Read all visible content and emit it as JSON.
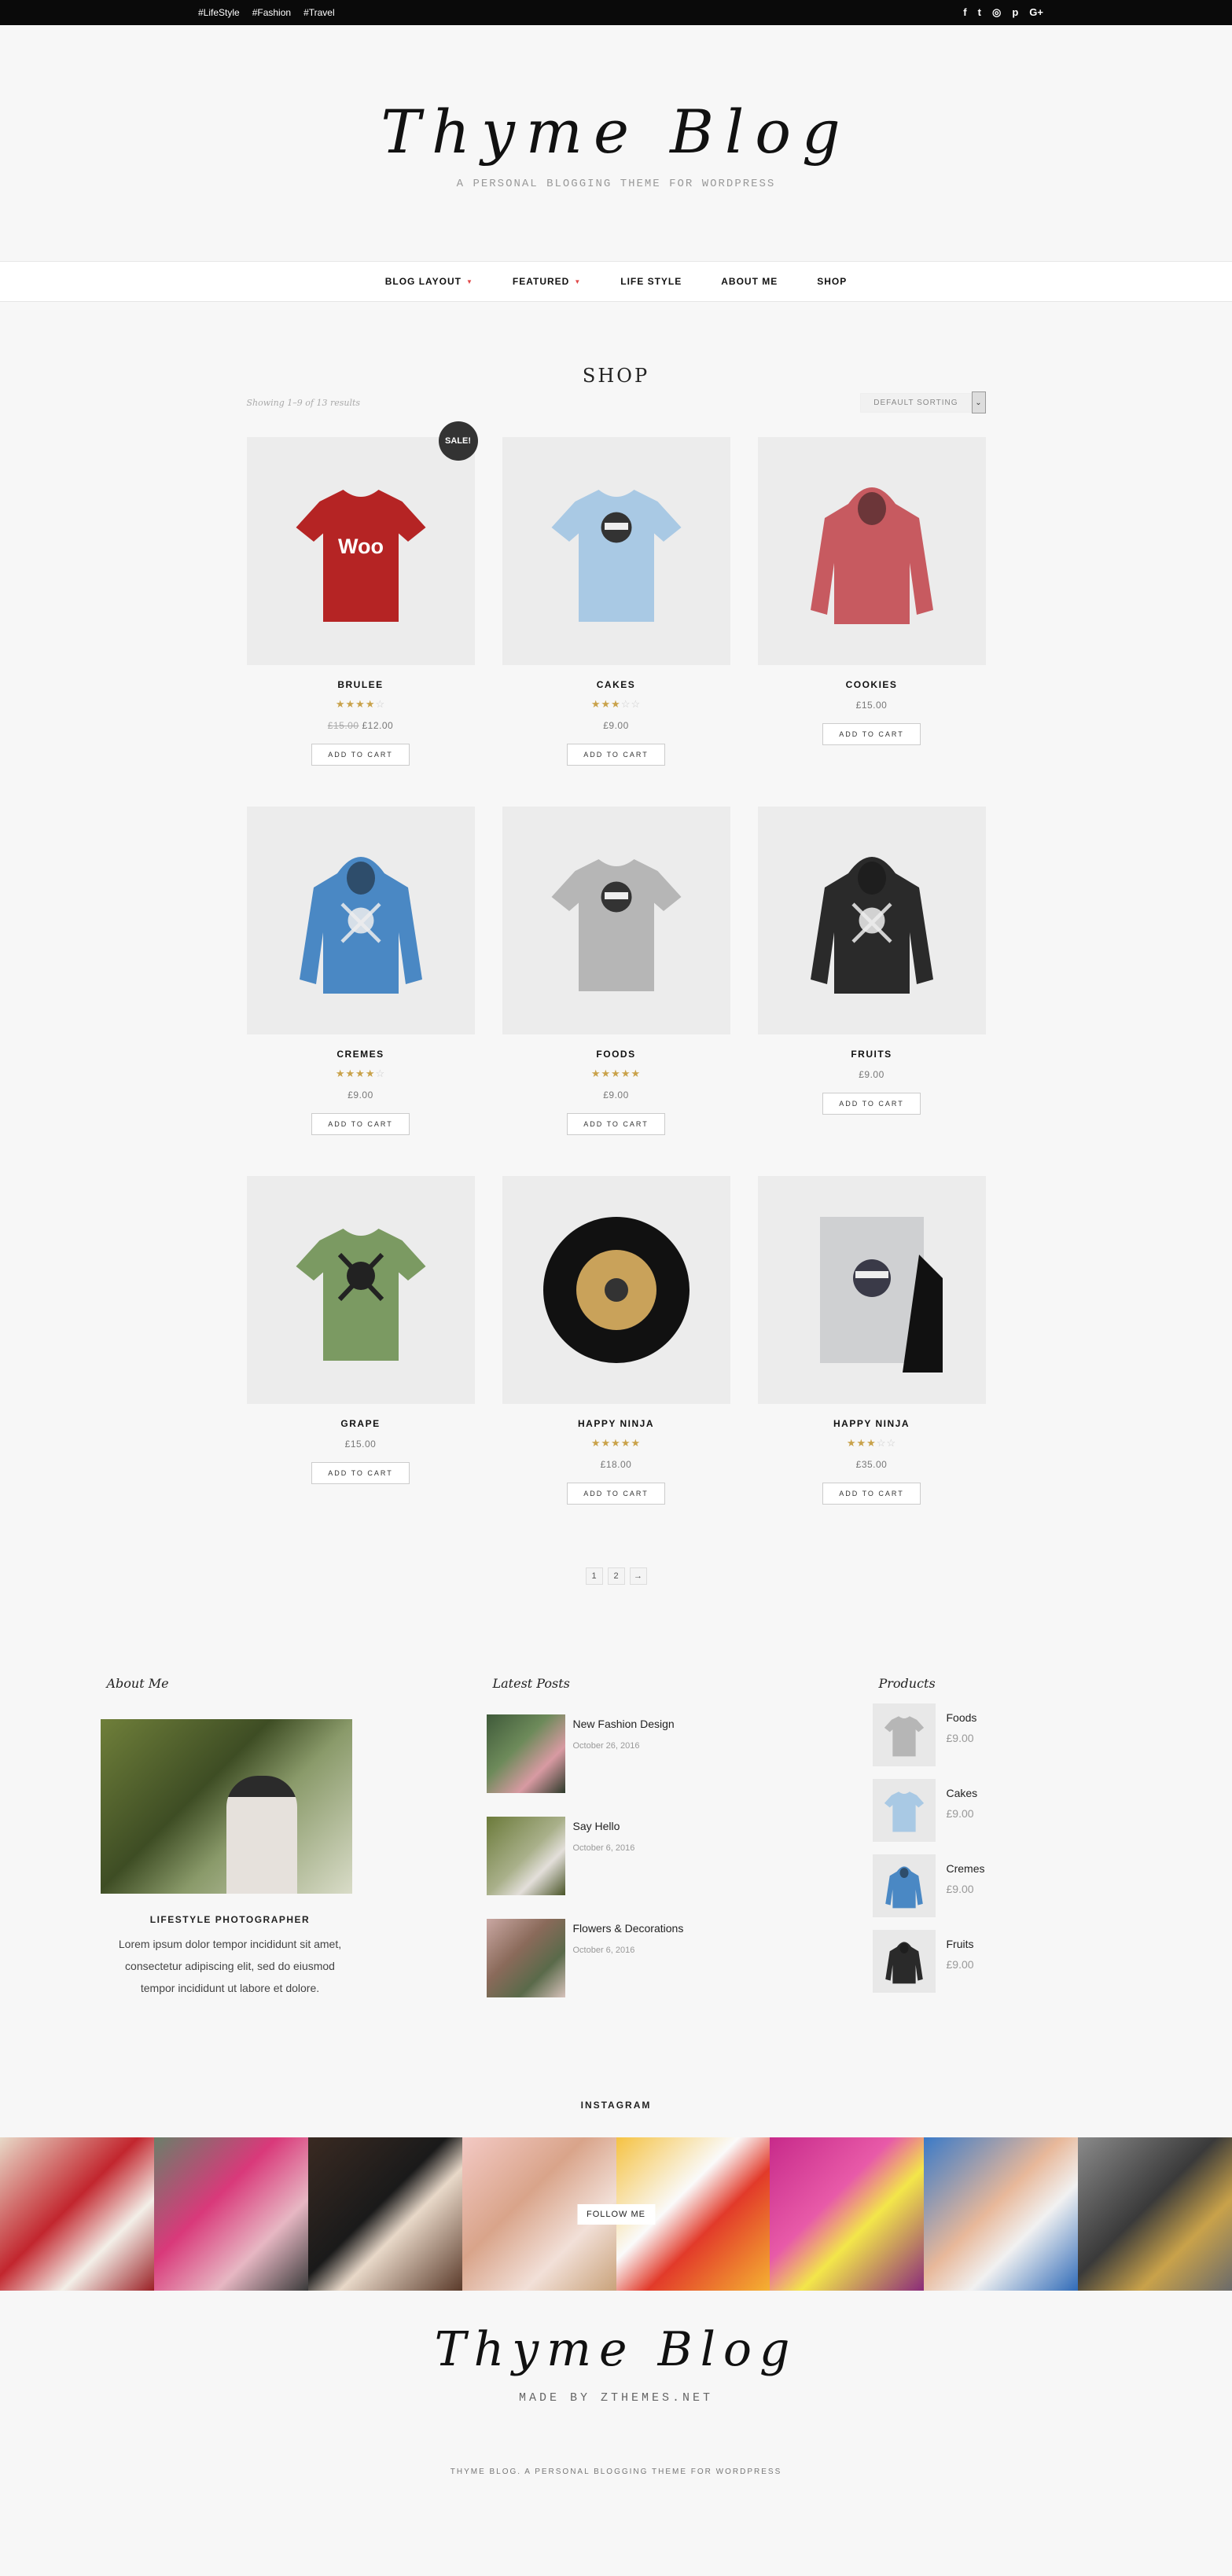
{
  "topbar": {
    "tags": [
      "#LifeStyle",
      "#Fashion",
      "#Travel"
    ],
    "social_icons": [
      "facebook-icon",
      "twitter-icon",
      "instagram-icon",
      "pinterest-icon",
      "google-plus-icon"
    ],
    "social_glyphs": [
      "f",
      "t",
      "◎",
      "p",
      "G+"
    ]
  },
  "header": {
    "logo": "Thyme Blog",
    "tagline": "A PERSONAL BLOGGING THEME FOR WORDPRESS"
  },
  "nav": {
    "items": [
      {
        "label": "BLOG LAYOUT",
        "dropdown": true
      },
      {
        "label": "FEATURED",
        "dropdown": true
      },
      {
        "label": "LIFE STYLE",
        "dropdown": false
      },
      {
        "label": "ABOUT ME",
        "dropdown": false
      },
      {
        "label": "SHOP",
        "dropdown": false
      }
    ]
  },
  "shop": {
    "title": "SHOP",
    "results": "Showing 1–9 of 13 results",
    "sort_label": "DEFAULT SORTING",
    "sale_badge": "SALE!",
    "add_to_cart": "ADD TO CART",
    "products": [
      {
        "name": "BRULEE",
        "rating": 4,
        "old_price": "£15.00",
        "price": "£12.00",
        "sale": true,
        "kind": "tee",
        "color": "#b52424",
        "print": "Woo"
      },
      {
        "name": "CAKES",
        "rating": 3,
        "old_price": "",
        "price": "£9.00",
        "sale": false,
        "kind": "tee",
        "color": "#a9c9e4",
        "print": "ninja"
      },
      {
        "name": "COOKIES",
        "rating": 0,
        "old_price": "",
        "price": "£15.00",
        "sale": false,
        "kind": "hoodie",
        "color": "#c75a60",
        "print": ""
      },
      {
        "name": "CREMES",
        "rating": 4,
        "old_price": "",
        "price": "£9.00",
        "sale": false,
        "kind": "hoodie",
        "color": "#4a88c4",
        "print": "skull"
      },
      {
        "name": "FOODS",
        "rating": 5,
        "old_price": "",
        "price": "£9.00",
        "sale": false,
        "kind": "tee",
        "color": "#b6b6b6",
        "print": "ninja"
      },
      {
        "name": "FRUITS",
        "rating": 0,
        "old_price": "",
        "price": "£9.00",
        "sale": false,
        "kind": "hoodie",
        "color": "#2a2a2a",
        "print": "skull"
      },
      {
        "name": "GRAPE",
        "rating": 0,
        "old_price": "",
        "price": "£15.00",
        "sale": false,
        "kind": "tee",
        "color": "#7b9a62",
        "print": "skull"
      },
      {
        "name": "HAPPY NINJA",
        "rating": 5,
        "old_price": "",
        "price": "£18.00",
        "sale": false,
        "kind": "vinyl",
        "color": "#111111",
        "print": ""
      },
      {
        "name": "HAPPY NINJA",
        "rating": 3,
        "old_price": "",
        "price": "£35.00",
        "sale": false,
        "kind": "poster",
        "color": "#cfd0d2",
        "print": ""
      }
    ],
    "pages": [
      "1",
      "2",
      "→"
    ]
  },
  "widgets": {
    "about": {
      "title": "About Me",
      "role": "LIFESTYLE PHOTOGRAPHER",
      "text": "Lorem ipsum dolor tempor incididunt sit amet, consectetur adipiscing elit, sed do eiusmod tempor incididunt ut labore et dolore."
    },
    "posts": {
      "title": "Latest Posts",
      "items": [
        {
          "title": "New Fashion Design",
          "date": "October 26, 2016",
          "thumb": "linear-gradient(135deg,#3f5a3a,#6d8a5a 40%,#d89aa2 70%,#2d3a2a)"
        },
        {
          "title": "Say Hello",
          "date": "October 6, 2016",
          "thumb": "linear-gradient(135deg,#6b7a3a,#a9b08a 50%,#e3dfda 70%,#4a5528)"
        },
        {
          "title": "Flowers & Decorations",
          "date": "October 6, 2016",
          "thumb": "linear-gradient(135deg,#c9a7a2,#8a6a5a 40%,#5a6a4a 70%,#d7c2bb)"
        }
      ]
    },
    "products": {
      "title": "Products",
      "items": [
        {
          "name": "Foods",
          "price": "£9.00",
          "color": "#b6b6b6",
          "kind": "tee"
        },
        {
          "name": "Cakes",
          "price": "£9.00",
          "color": "#a9c9e4",
          "kind": "tee"
        },
        {
          "name": "Cremes",
          "price": "£9.00",
          "color": "#4a88c4",
          "kind": "hoodie"
        },
        {
          "name": "Fruits",
          "price": "£9.00",
          "color": "#2a2a2a",
          "kind": "hoodie"
        }
      ]
    }
  },
  "instagram": {
    "title": "INSTAGRAM",
    "follow": "FOLLOW ME",
    "tiles": [
      "linear-gradient(135deg,#e8d9c8,#c2262e 45%,#f3efe8 70%,#9a1f24)",
      "linear-gradient(135deg,#6a7f6a,#d9397a 40%,#e7b7c3 70%,#3a3a3a)",
      "linear-gradient(135deg,#3a2a22,#1a1a1a 45%,#e8d8c8 60%,#5a3a2a)",
      "linear-gradient(135deg,#f3c9c4,#d9a48a 40%,#f2e0d8 70%,#c9a27a)",
      "linear-gradient(135deg,#f5c242,#fafafa 40%,#e23a2a 60%,#f5b232)",
      "linear-gradient(135deg,#c72a8a,#e85aa8 40%,#f3e64a 60%,#8a2a7a)",
      "linear-gradient(135deg,#3a7ac8,#e8b89a 45%,#f1f1f1 65%,#2f6ab8)",
      "linear-gradient(135deg,#8a8a8a,#3a3a3a 45%,#c9a24a 70%,#6a6a6a)"
    ]
  },
  "footer": {
    "logo": "Thyme Blog",
    "made_by": "MADE BY ZTHEMES.NET",
    "copyright": "THYME BLOG. A PERSONAL BLOGGING THEME FOR WORDPRESS"
  }
}
